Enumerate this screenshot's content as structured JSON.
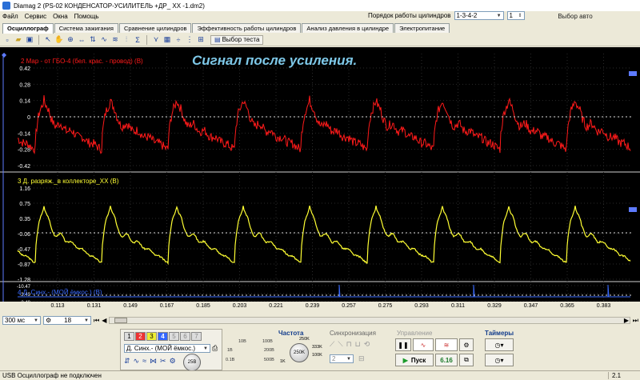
{
  "window": {
    "title": "Diamag 2 (PS-02 КОНДЕНСАТОР-УСИЛИТЕЛЬ +ДР_ ХХ -1.dm2)"
  },
  "menu": [
    "Файл",
    "Сервис",
    "Окна",
    "Помощь"
  ],
  "cylinder_order": {
    "label": "Порядок работы цилиндров",
    "value": "1-3-4-2",
    "spinner": "1"
  },
  "auto_select": "Выбор авто",
  "tabs": [
    "Осциллограф",
    "Система зажигания",
    "Сравнение цилиндров",
    "Эффективность работы цилиндров",
    "Анализ давления в цилиндре",
    "Электропитание"
  ],
  "toolbar": {
    "test_select": "Выбор теста"
  },
  "scope": {
    "overlay_title": "Сигнал после усиления.",
    "colors": {
      "ch2": "#ff1a1a",
      "ch3": "#ffff33",
      "ch4": "#3a6bff",
      "grid": "#2a2a2a",
      "overlay": "#7ec8e8"
    },
    "channels": [
      {
        "name": "2 Мар - от ГБО-4 (бел. крас. - провод) (В)",
        "ticks": [
          "0.42",
          "0.28",
          "0.14",
          "0",
          "-0.14",
          "-0.28",
          "-0.42"
        ]
      },
      {
        "name": "3 Д. разряж._в коллекторе_ХХ (В)",
        "ticks": [
          "1.16",
          "0.75",
          "0.35",
          "-0.06",
          "-0.47",
          "-0.87",
          "-1.28"
        ]
      },
      {
        "name": "4 Д. Синх.- (МОЙ ёмкос.) (В)",
        "ticks": [
          "-10.47",
          "-3.49",
          "3.49"
        ]
      }
    ],
    "x_ticks": [
      "0.113",
      "0.131",
      "0.149",
      "0.167",
      "0.185",
      "0.203",
      "0.221",
      "0.239",
      "0.257",
      "0.275",
      "0.293",
      "0.311",
      "0.329",
      "0.347",
      "0.365",
      "0.383"
    ]
  },
  "bottom": {
    "timebase": "300 мс",
    "samples": "18"
  },
  "controls": {
    "channel_buttons": [
      "1",
      "2",
      "3",
      "4",
      "5",
      "6",
      "7"
    ],
    "channel_select": "Д. Синх.- (МОЙ ёмкос.)",
    "range_labels": [
      "10B",
      "100B",
      "1B",
      "200B",
      "0.1B",
      "500B"
    ],
    "range_value": "25B",
    "freq_label": "Частота",
    "freq_scale": [
      "250K",
      "333K",
      "100K",
      "1K"
    ],
    "freq_value": "250K",
    "sync_label": "Синхронизация",
    "sync_value": "2",
    "control_label": "Управление",
    "start_label": "Пуск",
    "speed_value": "6.16",
    "timers_label": "Таймеры"
  },
  "status": {
    "text": "USB Осциллограф не подключен",
    "version": "2.1"
  }
}
